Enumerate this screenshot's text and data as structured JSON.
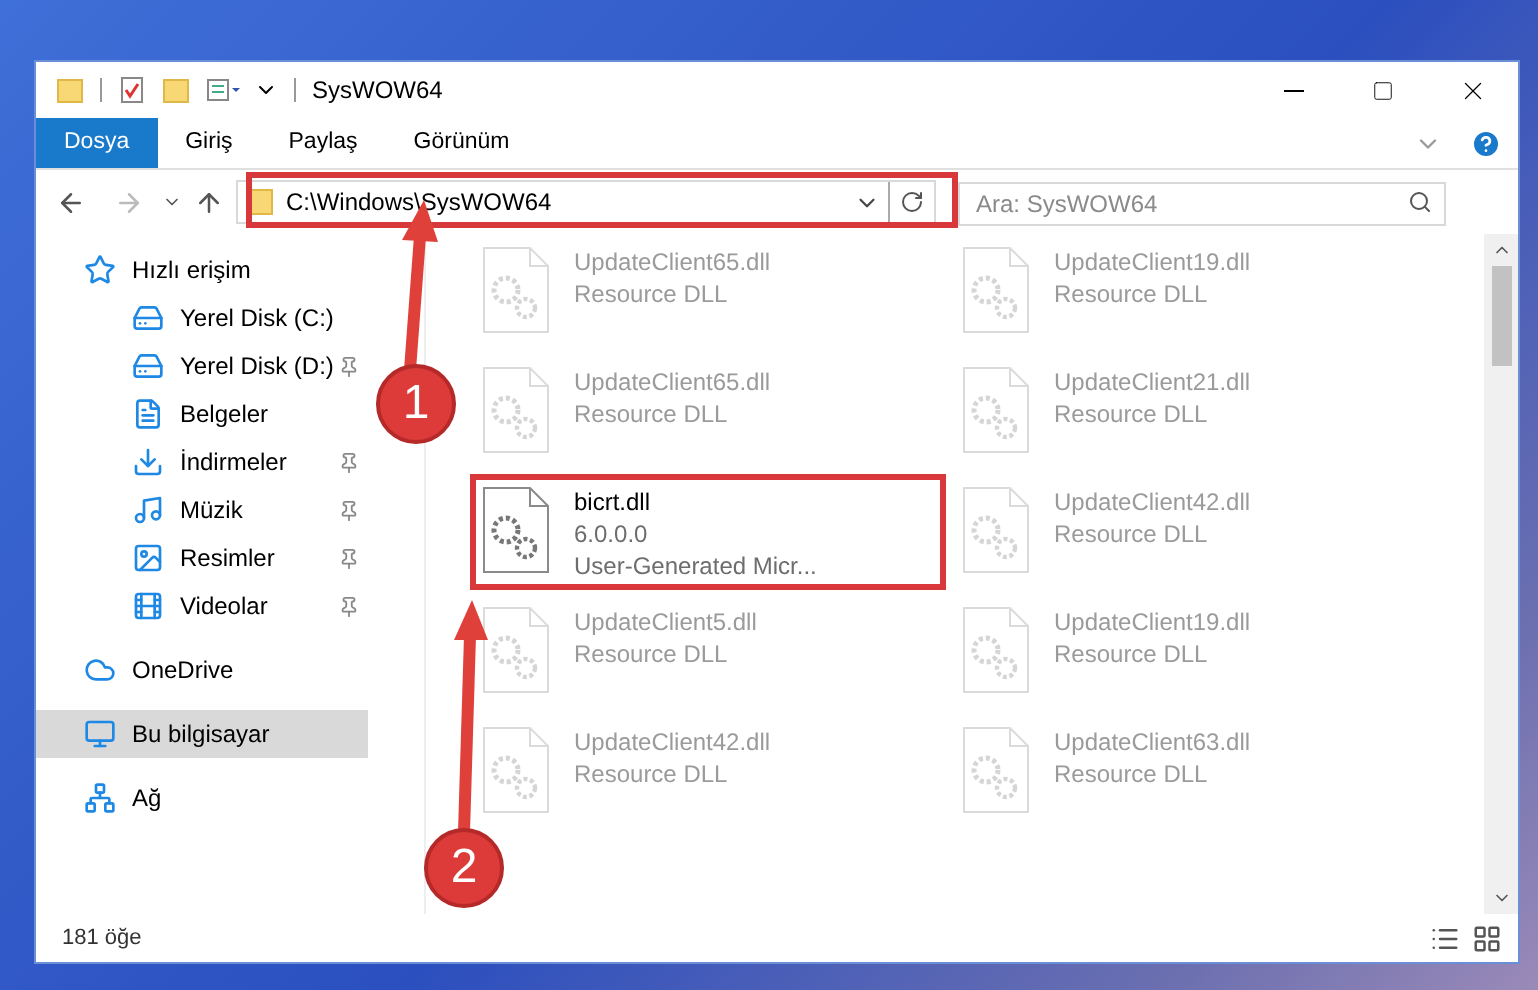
{
  "window": {
    "title": "SysWOW64"
  },
  "ribbon_tabs": [
    {
      "label": "Dosya",
      "selected": true
    },
    {
      "label": "Giriş",
      "selected": false
    },
    {
      "label": "Paylaş",
      "selected": false
    },
    {
      "label": "Görünüm",
      "selected": false
    }
  ],
  "address": {
    "path": "C:\\Windows\\SysWOW64"
  },
  "search": {
    "placeholder": "Ara: SysWOW64"
  },
  "nav": [
    {
      "label": "Hızlı erişim",
      "kind": "star",
      "selected": false,
      "children": [
        {
          "label": "Yerel Disk (C:)",
          "kind": "drive",
          "pinned": false,
          "selected": false
        },
        {
          "label": "Yerel Disk (D:)",
          "kind": "drive",
          "pinned": true,
          "selected": false
        },
        {
          "label": "Belgeler",
          "kind": "docs",
          "pinned": false,
          "selected": false
        },
        {
          "label": "İndirmeler",
          "kind": "download",
          "pinned": true,
          "selected": false
        },
        {
          "label": "Müzik",
          "kind": "music",
          "pinned": true,
          "selected": false
        },
        {
          "label": "Resimler",
          "kind": "pictures",
          "pinned": true,
          "selected": false
        },
        {
          "label": "Videolar",
          "kind": "videos",
          "pinned": true,
          "selected": false
        }
      ]
    },
    {
      "label": "OneDrive",
      "kind": "cloud",
      "selected": false
    },
    {
      "label": "Bu bilgisayar",
      "kind": "pc",
      "selected": true
    },
    {
      "label": "Ağ",
      "kind": "network",
      "selected": false
    }
  ],
  "files": [
    {
      "name": "UpdateClient65.dll",
      "line_2": "Resource DLL",
      "dimmed": true,
      "highlighted": false
    },
    {
      "name": "UpdateClient19.dll",
      "line_2": "Resource DLL",
      "dimmed": true,
      "highlighted": false
    },
    {
      "name": "UpdateClient65.dll",
      "line_2": "Resource DLL",
      "dimmed": true,
      "highlighted": false
    },
    {
      "name": "UpdateClient21.dll",
      "line_2": "Resource DLL",
      "dimmed": true,
      "highlighted": false
    },
    {
      "name": "bicrt.dll",
      "line_2": "6.0.0.0",
      "line_3": "User-Generated Micr...",
      "dimmed": false,
      "highlighted": true
    },
    {
      "name": "UpdateClient42.dll",
      "line_2": "Resource DLL",
      "dimmed": true,
      "highlighted": false
    },
    {
      "name": "UpdateClient5.dll",
      "line_2": "Resource DLL",
      "dimmed": true,
      "highlighted": false
    },
    {
      "name": "UpdateClient19.dll",
      "line_2": "Resource DLL",
      "dimmed": true,
      "highlighted": false
    },
    {
      "name": "UpdateClient42.dll",
      "line_2": "Resource DLL",
      "dimmed": true,
      "highlighted": false
    },
    {
      "name": "UpdateClient63.dll",
      "line_2": "Resource DLL",
      "dimmed": true,
      "highlighted": false
    }
  ],
  "status_bar": {
    "count": "181 öğe"
  },
  "annotations": [
    {
      "number": "1"
    },
    {
      "number": "2"
    }
  ]
}
